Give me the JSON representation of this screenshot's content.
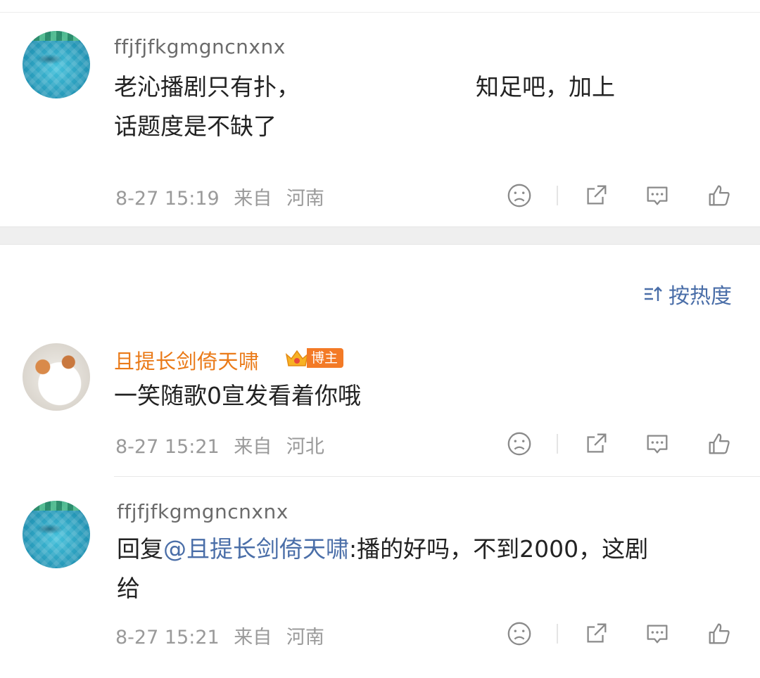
{
  "comments": [
    {
      "username": "ffjfjfkgmgncnxnx",
      "line1_a": "老沁播剧只有扑，",
      "line1_b": "知足吧，加上",
      "line2": "话题度是不缺了",
      "date": "8-27 15:19",
      "from_label": "来自",
      "location": "河南"
    },
    {
      "username": "且提长剑倚天啸",
      "badge": "博主",
      "line1": "一笑随歌0宣发看着你哦",
      "date": "8-27 15:21",
      "from_label": "来自",
      "location": "河北"
    },
    {
      "username": "ffjfjfkgmgncnxnx",
      "reply_prefix": "回复",
      "mention": "@且提长剑倚天啸",
      "line1_rest": ":播的好吗，不到2000，这剧",
      "line2": "给",
      "date": "8-27 15:21",
      "from_label": "来自",
      "location": "河南"
    }
  ],
  "sort": {
    "label": "按热度",
    "icon": "sort-icon"
  },
  "icons": [
    "dislike-face-icon",
    "share-icon",
    "comment-icon",
    "like-icon"
  ],
  "colors": {
    "accent": "#4a6ea8",
    "username_vip": "#ea7a18",
    "meta": "#9a9a9a",
    "badge": "#f37a26"
  }
}
